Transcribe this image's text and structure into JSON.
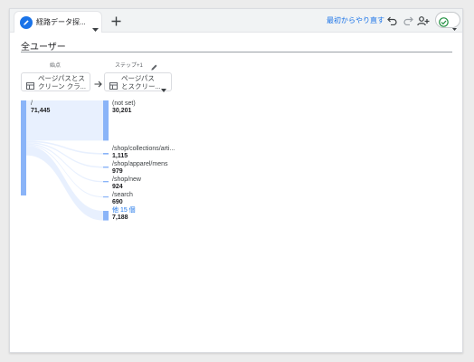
{
  "tab": {
    "label": "経路データ探...",
    "icon": "pencil-icon"
  },
  "toolbar": {
    "add_tab_icon": "plus-icon",
    "reset_label": "最初からやり直す",
    "undo_icon": "undo-icon",
    "redo_icon": "redo-icon",
    "share_icon": "add-person-icon",
    "status_icon": "check-circle-icon"
  },
  "segment": {
    "title": "全ユーザー"
  },
  "columns": {
    "start": {
      "header": "始点",
      "dimension_line1": "ページパスとス",
      "dimension_line2": "クリーン クラ..."
    },
    "step1": {
      "header": "ステップ+1",
      "dimension_line1": "ページパス",
      "dimension_line2": "とスクリー..."
    }
  },
  "colors": {
    "node": "#8ab4f8",
    "flow": "#e8f0fe",
    "accent": "#1a73e8"
  },
  "flow": {
    "start_node": {
      "name": "/",
      "value": "71,445"
    },
    "step1_nodes": [
      {
        "name": "(not set)",
        "value": "30,201"
      },
      {
        "name": "/shop/collections/arti...",
        "value": "1,115"
      },
      {
        "name": "/shop/apparel/mens",
        "value": "979"
      },
      {
        "name": "/shop/new",
        "value": "924"
      },
      {
        "name": "/search",
        "value": "690"
      },
      {
        "name": "他 15 個",
        "value": "7,188"
      }
    ]
  }
}
